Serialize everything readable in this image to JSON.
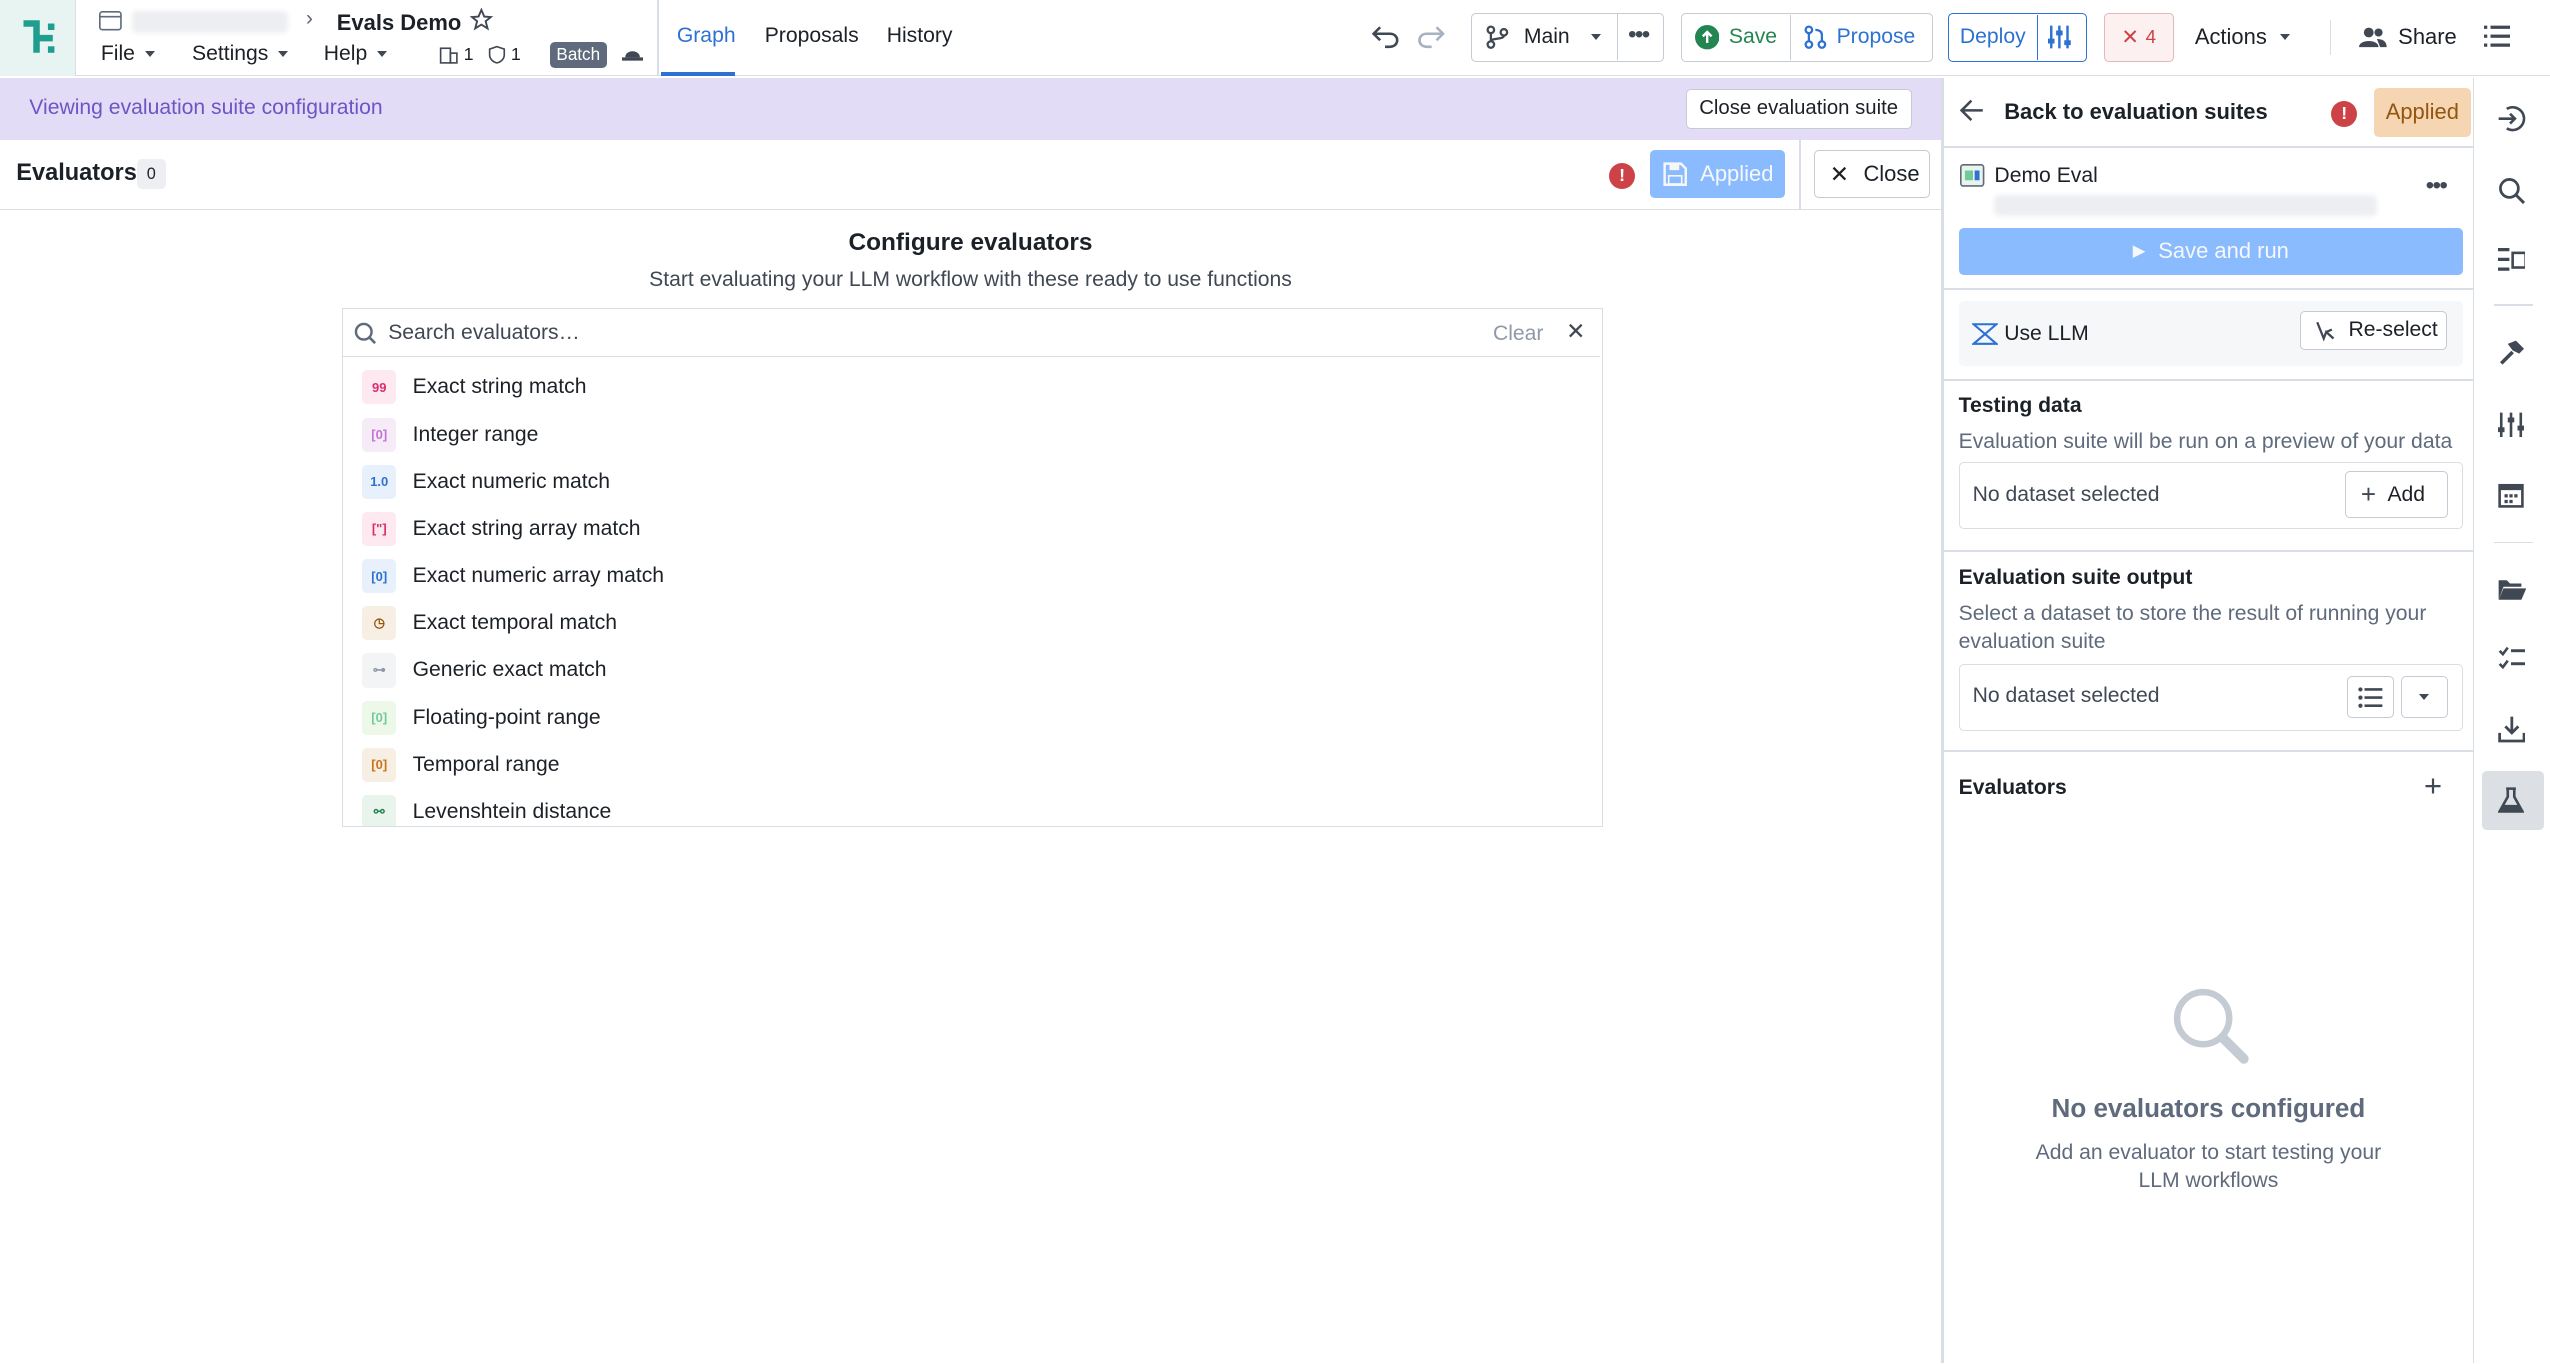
{
  "header": {
    "app_title": "Evals Demo",
    "menus": [
      {
        "label": "File"
      },
      {
        "label": "Settings"
      },
      {
        "label": "Help"
      }
    ],
    "stat_a": "1",
    "stat_b": "1",
    "batch_badge": "Batch",
    "tabs": [
      {
        "label": "Graph",
        "active": true
      },
      {
        "label": "Proposals",
        "active": false
      },
      {
        "label": "History",
        "active": false
      }
    ],
    "branch": "Main",
    "save_label": "Save",
    "propose_label": "Propose",
    "deploy_label": "Deploy",
    "error_count": "4",
    "actions_label": "Actions",
    "share_label": "Share"
  },
  "banner": {
    "text": "Viewing evaluation suite configuration",
    "close_label": "Close evaluation suite"
  },
  "evaluators_header": {
    "title": "Evaluators",
    "count": "0",
    "error_mark": "!",
    "applied_label": "Applied",
    "close_label": "Close"
  },
  "configure": {
    "title": "Configure evaluators",
    "subtitle": "Start evaluating your LLM workflow with these ready to use functions",
    "search_placeholder": "Search evaluators…",
    "clear_label": "Clear",
    "items": [
      {
        "label": "Exact string match",
        "icon": "quote-icon",
        "glyph": "99",
        "color": "#db2c6f",
        "bg": "#fde9ef"
      },
      {
        "label": "Integer range",
        "icon": "integer-range-icon",
        "glyph": "[0]",
        "color": "#c174d4",
        "bg": "#f6ecf8"
      },
      {
        "label": "Exact numeric match",
        "icon": "numeric-icon",
        "glyph": "1.0",
        "color": "#2d72d2",
        "bg": "#e8f0fb"
      },
      {
        "label": "Exact string array match",
        "icon": "string-array-icon",
        "glyph": "[\"]",
        "color": "#db2c6f",
        "bg": "#fde9ef"
      },
      {
        "label": "Exact numeric array match",
        "icon": "numeric-array-icon",
        "glyph": "[0]",
        "color": "#2d72d2",
        "bg": "#e8f0fb"
      },
      {
        "label": "Exact temporal match",
        "icon": "clock-icon",
        "glyph": "◷",
        "color": "#935610",
        "bg": "#f7eee4"
      },
      {
        "label": "Generic exact match",
        "icon": "link-icon",
        "glyph": "⊶",
        "color": "#8f99a8",
        "bg": "#f2f4f6"
      },
      {
        "label": "Floating-point range",
        "icon": "float-range-icon",
        "glyph": "[0]",
        "color": "#72ca9b",
        "bg": "#eef8e9"
      },
      {
        "label": "Temporal range",
        "icon": "temporal-range-icon",
        "glyph": "[0]",
        "color": "#c87619",
        "bg": "#f7eee4"
      },
      {
        "label": "Levenshtein distance",
        "icon": "levenshtein-icon",
        "glyph": "⚯",
        "color": "#238551",
        "bg": "#e8f4ec"
      }
    ]
  },
  "suite_panel": {
    "back_label": "Back to evaluation suites",
    "error_mark": "!",
    "applied_label": "Applied",
    "suite_name": "Demo Eval",
    "save_run_label": "Save and run",
    "function_label": "Use LLM",
    "reselect_label": "Re-select",
    "testing": {
      "title": "Testing data",
      "desc": "Evaluation suite will be run on a preview of your data",
      "empty": "No dataset selected",
      "add_label": "Add"
    },
    "output": {
      "title": "Evaluation suite output",
      "desc": "Select a dataset to store the result of running your evaluation suite",
      "empty": "No dataset selected"
    },
    "evaluators": {
      "title": "Evaluators",
      "empty_title": "No evaluators configured",
      "empty_desc": "Add an evaluator to start testing your LLM workflows"
    }
  },
  "colors": {
    "accent": "#2d72d2",
    "banner_bg": "#e3dcf7",
    "banner_text": "#6d55c4",
    "save_green": "#238551",
    "error_red": "#cd4246",
    "applied_orange": "#f6d6b2"
  }
}
